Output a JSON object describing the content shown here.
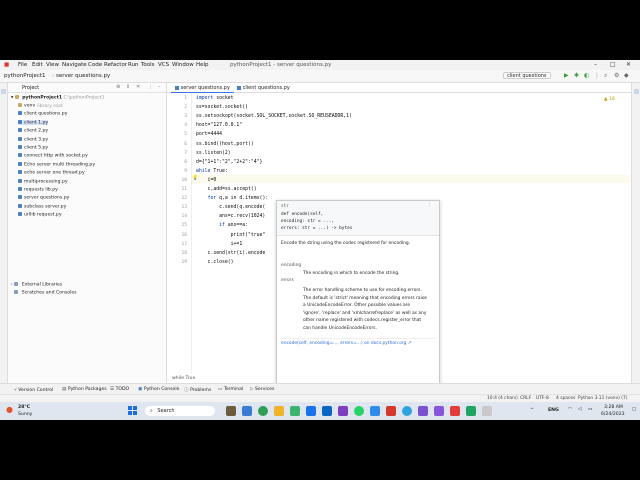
{
  "window": {
    "title": "pythonProject1 - server questions.py",
    "minimize": "–",
    "maximize": "□",
    "close": "✕"
  },
  "menu": [
    "File",
    "Edit",
    "View",
    "Navigate",
    "Code",
    "Refactor",
    "Run",
    "Tools",
    "VCS",
    "Window",
    "Help"
  ],
  "toolbar": {
    "project": "pythonProject1",
    "file": "server questions.py",
    "run_config": "client questions"
  },
  "project_panel": {
    "title": "Project",
    "root": "pythonProject1",
    "root_path": "C:\\pythonProject1",
    "items": [
      {
        "label": "venv",
        "note": "library root",
        "type": "folder"
      },
      {
        "label": "client questions.py",
        "type": "py"
      },
      {
        "label": "client 1.py",
        "type": "py",
        "selected": true
      },
      {
        "label": "client 2.py",
        "type": "py"
      },
      {
        "label": "client 3.py",
        "type": "py"
      },
      {
        "label": "client 5.py",
        "type": "py"
      },
      {
        "label": "connect http with socket.py",
        "type": "py"
      },
      {
        "label": "Echo server multi threading.py",
        "type": "py"
      },
      {
        "label": "echo server one thread.py",
        "type": "py"
      },
      {
        "label": "multiprocessing.py",
        "type": "py"
      },
      {
        "label": "requests lib.py",
        "type": "py"
      },
      {
        "label": "server questions.py",
        "type": "py"
      },
      {
        "label": "subclass server.py",
        "type": "py"
      },
      {
        "label": "urllib request.py",
        "type": "py"
      }
    ],
    "external": "External Libraries",
    "scratches": "Scratches and Consoles"
  },
  "tabs": [
    {
      "label": "server questions.py",
      "active": true
    },
    {
      "label": "client questions.py",
      "active": false
    }
  ],
  "warnings": "▲ 18",
  "code_lines": [
    "import socket",
    "ss=socket.socket()",
    "ss.setsockopt(socket.SOL_SOCKET,socket.SO_REUSEADDR,1)",
    "host=\"127.0.0.1\"",
    "port=4444",
    "ss.bind((host,port))",
    "ss.listen(2)",
    "d={\"1+1\":\"2\",\"2+2\":\"4\"}",
    "while True:",
    "    i=0",
    "    c,add=ss.accept()",
    "    for q,a in d.items():",
    "        c.send(q.encode(",
    "        ans=c.recv(1024)",
    "        if ans==a:",
    "            print(\"true\"",
    "            i+=1",
    "    c.send(str(i).encode",
    "    c.close()"
  ],
  "line_numbers": [
    "1",
    "2",
    "3",
    "4",
    "5",
    "6",
    "7",
    "8",
    "9",
    "10",
    "11",
    "12",
    "13",
    "14",
    "15",
    "16",
    "17",
    "18",
    "19"
  ],
  "doc_popup": {
    "sig_type": "str",
    "sig_line1": "def encode(self,",
    "sig_line2": "           encoding: str = ...,",
    "sig_line3": "           errors: str = ...) -> bytes",
    "summary": "Encode the string using the codec registered for encoding.",
    "param1_name": "encoding",
    "param1_desc": "The encoding in which to encode the string.",
    "param2_name": "errors",
    "param2_desc_lines": [
      "The error handling scheme to use for encoding errors.",
      "The default is 'strict' meaning that encoding errors raise",
      "a UnicodeEncodeError. Other possible values are",
      "'ignore', 'replace' and 'xmlcharrefreplace' as well as any",
      "other name registered with codecs.register_error that",
      "can handle UnicodeEncodeErrors."
    ],
    "link": "encode(self, encoding=..., errors=...)",
    "link_suffix": "on docs.python.org ↗"
  },
  "breadcrumb": "while True",
  "bottom_tabs": [
    "Version Control",
    "Python Packages",
    "TODO",
    "Python Console",
    "Problems",
    "Terminal",
    "Services"
  ],
  "status": {
    "position": "10:4 (4 chars)",
    "line_sep": "CRLF",
    "encoding": "UTF-8",
    "indent": "4 spaces",
    "interpreter": "Python 3.11 (venv) (7)"
  },
  "taskbar": {
    "weather_temp": "28°C",
    "weather_desc": "Sunny",
    "search": "Search",
    "lang": "ENG",
    "time": "3:28 AM",
    "date": "6/24/2023"
  },
  "colors": {
    "accent": "#3574f0",
    "selection": "#d5e1f7",
    "keyword": "#0033b3"
  }
}
